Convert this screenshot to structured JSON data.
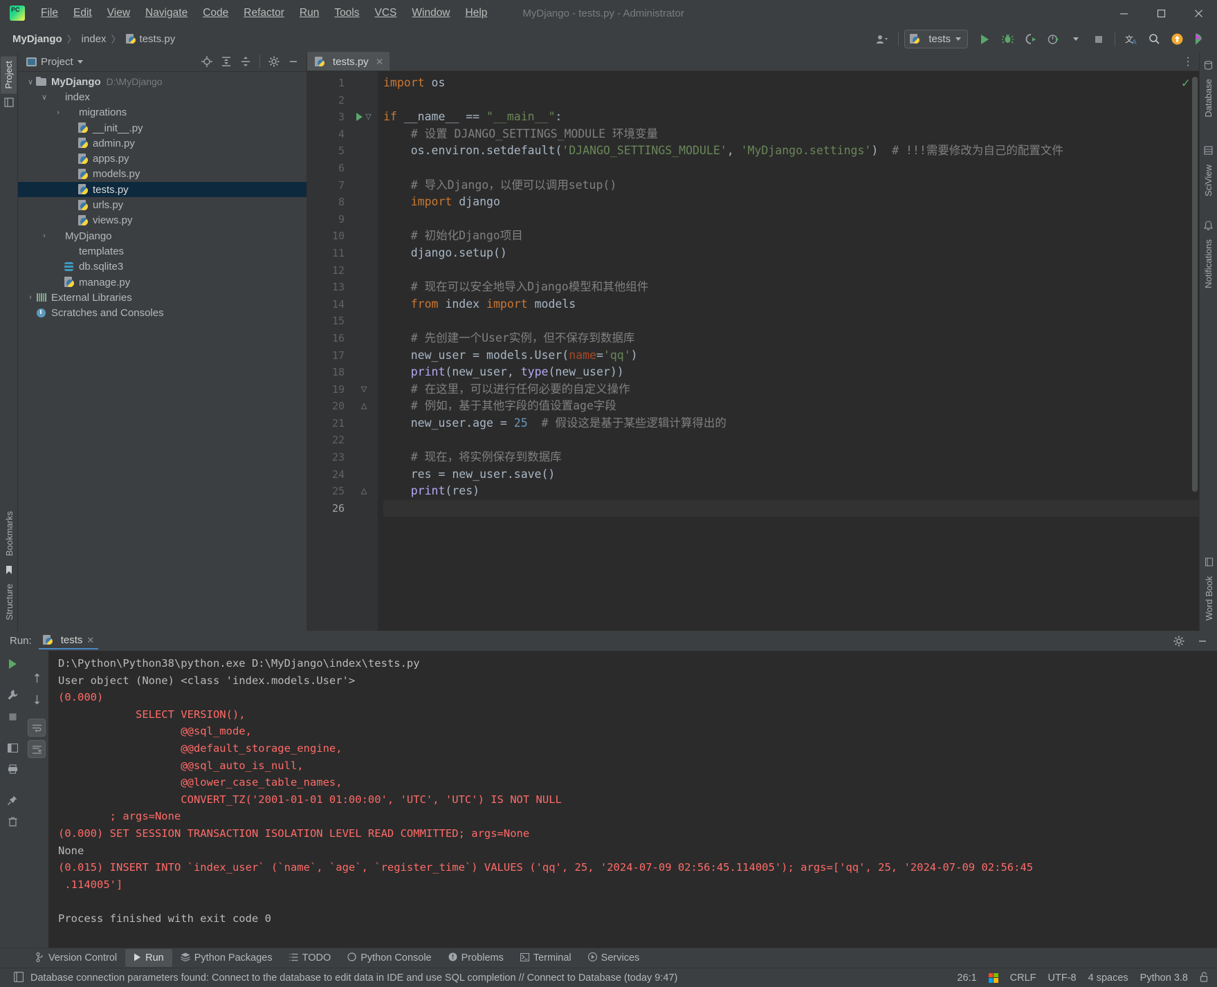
{
  "window": {
    "title": "MyDjango - tests.py - Administrator",
    "minimize": "–",
    "maximize": "☐",
    "close": "✕"
  },
  "menu": [
    {
      "label": "File"
    },
    {
      "label": "Edit"
    },
    {
      "label": "View"
    },
    {
      "label": "Navigate"
    },
    {
      "label": "Code"
    },
    {
      "label": "Refactor"
    },
    {
      "label": "Run"
    },
    {
      "label": "Tools"
    },
    {
      "label": "VCS"
    },
    {
      "label": "Window"
    },
    {
      "label": "Help"
    }
  ],
  "breadcrumb": {
    "project": "MyDjango",
    "folder": "index",
    "file": "tests.py",
    "sep": "〉"
  },
  "toolbar": {
    "run_config": "tests",
    "icons": [
      "user-account-icon",
      "run-icon",
      "debug-icon",
      "run-coverage-icon",
      "profile-icon",
      "stop-icon",
      "translate-icon",
      "search-everywhere-icon",
      "update-icon",
      "ide-feature-icon"
    ]
  },
  "left_strip": {
    "project_tab": "Project",
    "bookmarks_tab": "Bookmarks",
    "structure_tab": "Structure"
  },
  "right_strip": {
    "database_tab": "Database",
    "sciview_tab": "SciView",
    "notifications_tab": "Notifications",
    "word_book_tab": "Word Book"
  },
  "project_panel": {
    "title": "Project",
    "actions": [
      "locate-icon",
      "expand-all-icon",
      "collapse-all-icon",
      "settings-icon",
      "hide-icon"
    ],
    "tree": [
      {
        "label": "MyDjango",
        "path": "D:\\MyDjango",
        "icon": "folder",
        "depth": 0,
        "arrow": "∨",
        "bold": true,
        "selected": false
      },
      {
        "label": "index",
        "path": "",
        "icon": "folder-src",
        "depth": 1,
        "arrow": "∨",
        "bold": false,
        "selected": false
      },
      {
        "label": "migrations",
        "path": "",
        "icon": "folder-src",
        "depth": 2,
        "arrow": "›",
        "bold": false,
        "selected": false
      },
      {
        "label": "__init__.py",
        "path": "",
        "icon": "pyfile",
        "depth": 3,
        "arrow": "",
        "bold": false,
        "selected": false
      },
      {
        "label": "admin.py",
        "path": "",
        "icon": "pyfile",
        "depth": 3,
        "arrow": "",
        "bold": false,
        "selected": false
      },
      {
        "label": "apps.py",
        "path": "",
        "icon": "pyfile",
        "depth": 3,
        "arrow": "",
        "bold": false,
        "selected": false
      },
      {
        "label": "models.py",
        "path": "",
        "icon": "pyfile",
        "depth": 3,
        "arrow": "",
        "bold": false,
        "selected": false
      },
      {
        "label": "tests.py",
        "path": "",
        "icon": "pyfile",
        "depth": 3,
        "arrow": "",
        "bold": false,
        "selected": true
      },
      {
        "label": "urls.py",
        "path": "",
        "icon": "pyfile",
        "depth": 3,
        "arrow": "",
        "bold": false,
        "selected": false
      },
      {
        "label": "views.py",
        "path": "",
        "icon": "pyfile",
        "depth": 3,
        "arrow": "",
        "bold": false,
        "selected": false
      },
      {
        "label": "MyDjango",
        "path": "",
        "icon": "folder-src",
        "depth": 1,
        "arrow": "›",
        "bold": false,
        "selected": false
      },
      {
        "label": "templates",
        "path": "",
        "icon": "folder-purple",
        "depth": 2,
        "arrow": "",
        "bold": false,
        "selected": false
      },
      {
        "label": "db.sqlite3",
        "path": "",
        "icon": "db",
        "depth": 2,
        "arrow": "",
        "bold": false,
        "selected": false
      },
      {
        "label": "manage.py",
        "path": "",
        "icon": "pyfile",
        "depth": 2,
        "arrow": "",
        "bold": false,
        "selected": false
      },
      {
        "label": "External Libraries",
        "path": "",
        "icon": "lib",
        "depth": 0,
        "arrow": "›",
        "bold": false,
        "selected": false
      },
      {
        "label": "Scratches and Consoles",
        "path": "",
        "icon": "scratch",
        "depth": 0,
        "arrow": "",
        "bold": false,
        "selected": false
      }
    ]
  },
  "editor": {
    "tab": "tests.py",
    "tab_close": "✕",
    "options_icon": "⋮",
    "inspection_ok": "✓",
    "lines": [
      {
        "n": 1,
        "html": "<span class=\"kw\">import</span> <span class=\"plain\">os</span>",
        "fold": "",
        "runmark": false
      },
      {
        "n": 2,
        "html": "",
        "fold": "",
        "runmark": false
      },
      {
        "n": 3,
        "html": "<span class=\"kw\">if</span> <span class=\"plain\">__name__</span> <span class=\"plain\">==</span> <span class=\"str\">\"__main__\"</span><span class=\"plain\">:</span>",
        "fold": "▽",
        "runmark": true
      },
      {
        "n": 4,
        "html": "    <span class=\"cmt\"># 设置 DJANGO_SETTINGS_MODULE 环境变量</span>",
        "fold": "",
        "runmark": false
      },
      {
        "n": 5,
        "html": "    <span class=\"plain\">os.environ.setdefault(</span><span class=\"str\">'DJANGO_SETTINGS_MODULE'</span><span class=\"plain\">, </span><span class=\"str\">'MyDjango.settings'</span><span class=\"plain\">)</span>  <span class=\"cmt\"># !!!需要修改为自己的配置文件</span>",
        "fold": "",
        "runmark": false
      },
      {
        "n": 6,
        "html": "",
        "fold": "",
        "runmark": false
      },
      {
        "n": 7,
        "html": "    <span class=\"cmt\"># 导入Django，以便可以调用setup()</span>",
        "fold": "",
        "runmark": false
      },
      {
        "n": 8,
        "html": "    <span class=\"kw\">import</span> <span class=\"plain\">django</span>",
        "fold": "",
        "runmark": false
      },
      {
        "n": 9,
        "html": "",
        "fold": "",
        "runmark": false
      },
      {
        "n": 10,
        "html": "    <span class=\"cmt\"># 初始化Django项目</span>",
        "fold": "",
        "runmark": false
      },
      {
        "n": 11,
        "html": "    <span class=\"plain\">django.setup()</span>",
        "fold": "",
        "runmark": false
      },
      {
        "n": 12,
        "html": "",
        "fold": "",
        "runmark": false
      },
      {
        "n": 13,
        "html": "    <span class=\"cmt\"># 现在可以安全地导入Django模型和其他组件</span>",
        "fold": "",
        "runmark": false
      },
      {
        "n": 14,
        "html": "    <span class=\"kw\">from</span> <span class=\"plain\">index</span> <span class=\"kw\">import</span> <span class=\"plain\">models</span>",
        "fold": "",
        "runmark": false
      },
      {
        "n": 15,
        "html": "",
        "fold": "",
        "runmark": false
      },
      {
        "n": 16,
        "html": "    <span class=\"cmt\"># 先创建一个User实例，但不保存到数据库</span>",
        "fold": "",
        "runmark": false
      },
      {
        "n": 17,
        "html": "    <span class=\"plain\">new_user = models.User(</span><span class=\"kwarg\">name</span><span class=\"plain\">=</span><span class=\"str\">'qq'</span><span class=\"plain\">)</span>",
        "fold": "",
        "runmark": false
      },
      {
        "n": 18,
        "html": "    <span class=\"fn\">print</span><span class=\"plain\">(new_user, </span><span class=\"fn\">type</span><span class=\"plain\">(new_user))</span>",
        "fold": "",
        "runmark": false
      },
      {
        "n": 19,
        "html": "    <span class=\"cmt\"># 在这里，可以进行任何必要的自定义操作</span>",
        "fold": "▽",
        "runmark": false
      },
      {
        "n": 20,
        "html": "    <span class=\"cmt\"># 例如，基于其他字段的值设置age字段</span>",
        "fold": "△",
        "runmark": false
      },
      {
        "n": 21,
        "html": "    <span class=\"plain\">new_user.age = </span><span class=\"num\">25</span>  <span class=\"cmt\"># 假设这是基于某些逻辑计算得出的</span>",
        "fold": "",
        "runmark": false
      },
      {
        "n": 22,
        "html": "",
        "fold": "",
        "runmark": false
      },
      {
        "n": 23,
        "html": "    <span class=\"cmt\"># 现在，将实例保存到数据库</span>",
        "fold": "",
        "runmark": false
      },
      {
        "n": 24,
        "html": "    <span class=\"plain\">res = new_user.save()</span>",
        "fold": "",
        "runmark": false
      },
      {
        "n": 25,
        "html": "    <span class=\"fn\">print</span><span class=\"plain\">(res)</span>",
        "fold": "△",
        "runmark": false
      },
      {
        "n": 26,
        "html": "",
        "fold": "",
        "runmark": false,
        "current": true
      }
    ]
  },
  "run_window": {
    "label": "Run:",
    "tab": "tests",
    "tab_close": "✕",
    "settings_icon": "⚙",
    "hide_icon": "–",
    "side_buttons": [
      "rerun-icon",
      "wrench-icon",
      "stop-icon",
      "pin-icon",
      "trash-icon",
      "scroll-up-icon",
      "scroll-down-icon",
      "soft-wrap-icon",
      "scroll-end-icon",
      "layout-icon",
      "print-icon"
    ],
    "console_lines": [
      {
        "text": "D:\\Python\\Python38\\python.exe D:\\MyDjango\\index\\tests.py",
        "color": "wht"
      },
      {
        "text": "User object (None) <class 'index.models.User'>",
        "color": "wht"
      },
      {
        "text": "(0.000)",
        "color": "red"
      },
      {
        "text": "            SELECT VERSION(),",
        "color": "red"
      },
      {
        "text": "                   @@sql_mode,",
        "color": "red"
      },
      {
        "text": "                   @@default_storage_engine,",
        "color": "red"
      },
      {
        "text": "                   @@sql_auto_is_null,",
        "color": "red"
      },
      {
        "text": "                   @@lower_case_table_names,",
        "color": "red"
      },
      {
        "text": "                   CONVERT_TZ('2001-01-01 01:00:00', 'UTC', 'UTC') IS NOT NULL",
        "color": "red"
      },
      {
        "text": "        ; args=None",
        "color": "red"
      },
      {
        "text": "(0.000) SET SESSION TRANSACTION ISOLATION LEVEL READ COMMITTED; args=None",
        "color": "red"
      },
      {
        "text": "None",
        "color": "wht"
      },
      {
        "text": "(0.015) INSERT INTO `index_user` (`name`, `age`, `register_time`) VALUES ('qq', 25, '2024-07-09 02:56:45.114005'); args=['qq', 25, '2024-07-09 02:56:45",
        "color": "red"
      },
      {
        "text": " .114005']",
        "color": "red"
      },
      {
        "text": "",
        "color": "wht"
      },
      {
        "text": "Process finished with exit code 0",
        "color": "wht"
      }
    ]
  },
  "bottom_bar": [
    {
      "label": "Version Control",
      "icon": "branch-icon",
      "selected": false
    },
    {
      "label": "Run",
      "icon": "run-icon",
      "selected": true
    },
    {
      "label": "Python Packages",
      "icon": "packages-icon",
      "selected": false
    },
    {
      "label": "TODO",
      "icon": "todo-icon",
      "selected": false
    },
    {
      "label": "Python Console",
      "icon": "python-icon",
      "selected": false
    },
    {
      "label": "Problems",
      "icon": "problems-icon",
      "selected": false
    },
    {
      "label": "Terminal",
      "icon": "terminal-icon",
      "selected": false
    },
    {
      "label": "Services",
      "icon": "services-icon",
      "selected": false
    }
  ],
  "status_bar": {
    "message": "Database connection parameters found: Connect to the database to edit data in IDE and use SQL completion // Connect to Database (today 9:47)",
    "caret": "26:1",
    "line_sep": "CRLF",
    "encoding": "UTF-8",
    "indent": "4 spaces",
    "interpreter": "Python 3.8",
    "lock_icon": "🔓"
  },
  "colors": {
    "accent_blue": "#4a88c7",
    "selection": "#0d293e",
    "green": "#59a869",
    "error_red": "#ff6b68",
    "bg_panel": "#3c3f41",
    "bg_editor": "#2b2b2b"
  }
}
